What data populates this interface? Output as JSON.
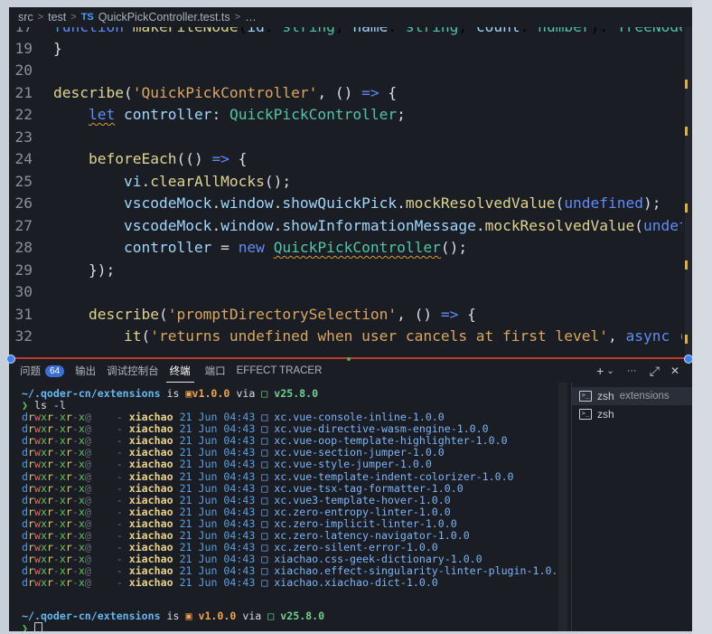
{
  "breadcrumb": {
    "seg1": "src",
    "seg2": "test",
    "file_badge": "TS",
    "file": "QuickPickController.test.ts",
    "more": "…"
  },
  "editor": {
    "lines": [
      {
        "n": "17",
        "text": "function makeFileNode(id: string, name: string, count: number): TreeNode"
      },
      {
        "n": "19",
        "text": "}"
      },
      {
        "n": "20",
        "text": ""
      },
      {
        "n": "21",
        "text": "describe('QuickPickController', () => {"
      },
      {
        "n": "22",
        "text": "    let controller: QuickPickController;"
      },
      {
        "n": "23",
        "text": ""
      },
      {
        "n": "24",
        "text": "    beforeEach(() => {"
      },
      {
        "n": "25",
        "text": "        vi.clearAllMocks();"
      },
      {
        "n": "26",
        "text": "        vscodeMock.window.showQuickPick.mockResolvedValue(undefined);"
      },
      {
        "n": "27",
        "text": "        vscodeMock.window.showInformationMessage.mockResolvedValue(undefi"
      },
      {
        "n": "28",
        "text": "        controller = new QuickPickController();"
      },
      {
        "n": "29",
        "text": "    });"
      },
      {
        "n": "30",
        "text": ""
      },
      {
        "n": "31",
        "text": "    describe('promptDirectorySelection', () => {"
      },
      {
        "n": "32",
        "text": "        it('returns undefined when user cancels at first level', async ()"
      }
    ]
  },
  "panel": {
    "tabs": {
      "problems": "问题",
      "problems_count": "64",
      "output": "输出",
      "debug": "调试控制台",
      "terminal": "终端",
      "ports": "端口",
      "effect": "EFFECT TRACER"
    },
    "actions": {
      "add": "+",
      "dropdown": "⌄",
      "more": "···",
      "maximize": "⤢",
      "close": "✕"
    }
  },
  "terminal": {
    "prompt": {
      "path": "~/.qoder-cn/extensions",
      "is": "is",
      "pkg": "v1.0.0",
      "via": "via",
      "node": "v25.8.0",
      "arrow": "❯"
    },
    "command": "ls -l",
    "perms": "drwxr-xr-x@",
    "dash": "-",
    "owner": "xiachao",
    "date": "21 Jun 04:43",
    "entries": [
      "xc.vue-console-inline-1.0.0",
      "xc.vue-directive-wasm-engine-1.0.0",
      "xc.vue-oop-template-highlighter-1.0.0",
      "xc.vue-section-jumper-1.0.0",
      "xc.vue-style-jumper-1.0.0",
      "xc.vue-template-indent-colorizer-1.0.0",
      "xc.vue-tsx-tag-formatter-1.0.0",
      "xc.vue3-template-hover-1.0.0",
      "xc.zero-entropy-linter-1.0.0",
      "xc.zero-implicit-linter-1.0.0",
      "xc.zero-latency-navigator-1.0.0",
      "xc.zero-silent-error-1.0.0",
      "xiachao.css-geek-dictionary-1.0.0",
      "xiachao.effect-singularity-linter-plugin-1.0.0",
      "xiachao.xiachao-dict-1.0.0"
    ],
    "sessions": [
      {
        "name": "zsh",
        "sub": "extensions"
      },
      {
        "name": "zsh",
        "sub": ""
      }
    ]
  }
}
